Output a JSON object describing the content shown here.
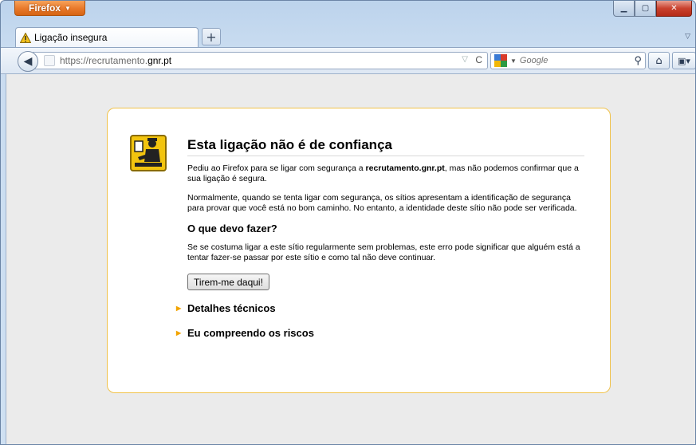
{
  "browser": {
    "app_button_label": "Firefox",
    "tab_title": "Ligação insegura",
    "url_prefix": "https://recrutamento.",
    "url_domain": "gnr.pt",
    "search_placeholder": "Google"
  },
  "error": {
    "title": "Esta ligação não é de confiança",
    "para1_before": "Pediu ao Firefox para se ligar com segurança a ",
    "para1_host": "recrutamento.gnr.pt",
    "para1_after": ", mas não podemos confirmar que a sua ligação é segura.",
    "para2": "Normalmente, quando se tenta ligar com segurança, os sítios apresentam a identificação de segurança para provar que você está no bom caminho. No entanto, a identidade deste sítio não pode ser verificada.",
    "what_to_do_title": "O que devo fazer?",
    "para3": "Se se costuma ligar a este sítio regularmente sem problemas, este erro pode significar que alguém está a tentar fazer-se passar por este sítio e como tal não deve continuar.",
    "get_out_button": "Tirem-me daqui!",
    "technical_details": "Detalhes técnicos",
    "understand_risks": "Eu compreendo os riscos"
  },
  "colors": {
    "accent_orange": "#e8782a",
    "box_border": "#f0c24a",
    "page_bg": "#ebebeb"
  },
  "icons": [
    "warning-icon",
    "back-arrow-icon",
    "site-identity-icon",
    "bookmark-star-icon",
    "reload-icon",
    "google-icon",
    "search-icon",
    "home-icon",
    "extension-icon",
    "cert-error-icon"
  ]
}
